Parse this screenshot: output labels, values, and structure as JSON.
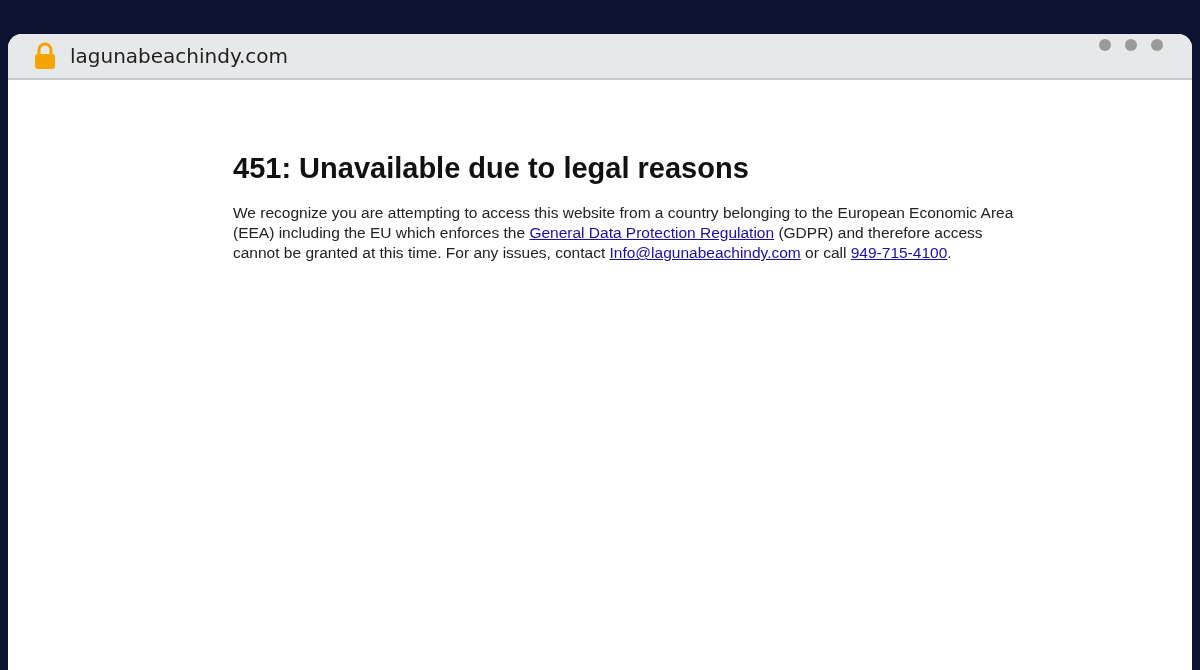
{
  "browser": {
    "address": "lagunabeachindy.com"
  },
  "page": {
    "heading": "451: Unavailable due to legal reasons",
    "paragraph": [
      {
        "kind": "text",
        "text": "We recognize you are attempting to access this website from a country belonging to the European Economic Area (EEA) including the EU which enforces the "
      },
      {
        "kind": "link",
        "text": "General Data Protection Regulation"
      },
      {
        "kind": "text",
        "text": " (GDPR) and therefore access cannot be granted at this time. For any issues, contact "
      },
      {
        "kind": "link",
        "text": "Info@lagunabeachindy.com"
      },
      {
        "kind": "text",
        "text": " or call "
      },
      {
        "kind": "link",
        "text": "949-715-4100"
      },
      {
        "kind": "text",
        "text": "."
      }
    ]
  }
}
